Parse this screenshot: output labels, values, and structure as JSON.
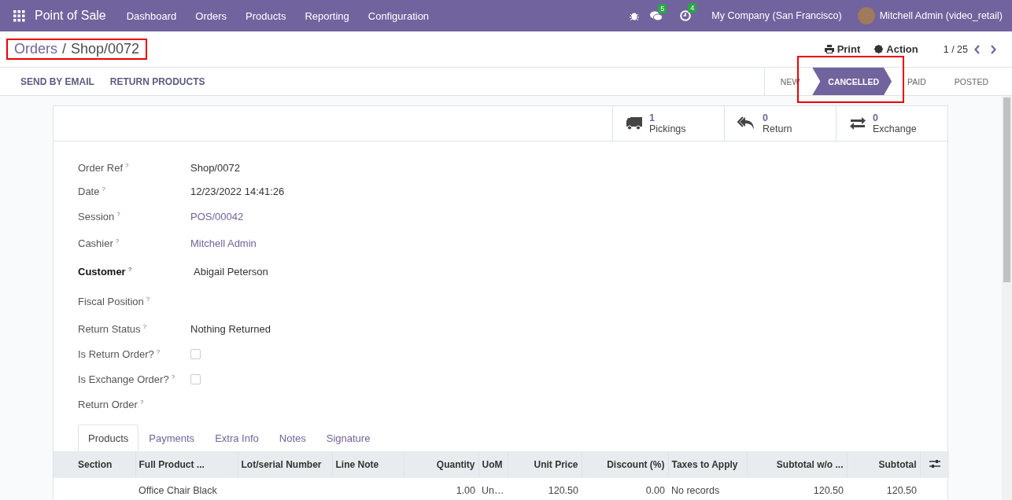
{
  "navbar": {
    "app": "Point of Sale",
    "menus": [
      "Dashboard",
      "Orders",
      "Products",
      "Reporting",
      "Configuration"
    ],
    "messages_count": "5",
    "activities_count": "4",
    "company": "My Company (San Francisco)",
    "user": "Mitchell Admin (video_retail)"
  },
  "breadcrumb": {
    "parent": "Orders",
    "separator": "/",
    "current": "Shop/0072"
  },
  "actions": [
    {
      "kind": "print",
      "label": "Print"
    },
    {
      "kind": "action",
      "label": "Action"
    }
  ],
  "pager": "1 / 25",
  "header_buttons": [
    "SEND BY EMAIL",
    "RETURN PRODUCTS"
  ],
  "statusbar": [
    {
      "label": "NEW",
      "selected": false
    },
    {
      "label": "CANCELLED",
      "selected": true
    },
    {
      "label": "PAID",
      "selected": false
    },
    {
      "label": "POSTED",
      "selected": false
    }
  ],
  "smart_buttons": [
    {
      "kind": "truck",
      "count": "1",
      "label": "Pickings"
    },
    {
      "kind": "return",
      "count": "0",
      "label": "Return"
    },
    {
      "kind": "exchange",
      "count": "0",
      "label": "Exchange"
    }
  ],
  "fields": [
    {
      "label": "Order Ref",
      "kind": "text",
      "value": "Shop/0072",
      "required": false
    },
    {
      "label": "Date",
      "kind": "text",
      "value": "12/23/2022 14:41:26",
      "required": false
    },
    {
      "label": "Session",
      "kind": "link",
      "value": "POS/00042",
      "required": false
    },
    {
      "label": "Cashier",
      "kind": "link",
      "value": "Mitchell Admin",
      "required": false
    },
    {
      "label": "Customer",
      "kind": "text",
      "value": "Abigail Peterson",
      "required": true
    },
    {
      "label": "Fiscal Position",
      "kind": "empty",
      "required": false
    },
    {
      "label": "Return Status",
      "kind": "text",
      "value": "Nothing Returned",
      "required": false
    },
    {
      "label": "Is Return Order?",
      "kind": "checkbox",
      "checked": false,
      "required": false
    },
    {
      "label": "Is Exchange Order?",
      "kind": "checkbox",
      "checked": false,
      "required": false
    },
    {
      "label": "Return Order",
      "kind": "empty",
      "required": false
    }
  ],
  "help_mark": "?",
  "tabs": [
    {
      "label": "Products",
      "selected": true
    },
    {
      "label": "Payments",
      "selected": false
    },
    {
      "label": "Extra Info",
      "selected": false
    },
    {
      "label": "Notes",
      "selected": false
    },
    {
      "label": "Signature",
      "selected": false
    }
  ],
  "table": {
    "columns": [
      {
        "label": "Section",
        "kind": "text"
      },
      {
        "label": "Full Product ...",
        "kind": "text"
      },
      {
        "label": "Lot/serial Number",
        "kind": "text"
      },
      {
        "label": "Line Note",
        "kind": "text"
      },
      {
        "label": "Quantity",
        "kind": "number"
      },
      {
        "label": "UoM",
        "kind": "text"
      },
      {
        "label": "Unit Price",
        "kind": "number"
      },
      {
        "label": "Discount (%)",
        "kind": "number"
      },
      {
        "label": "Taxes to Apply",
        "kind": "text"
      },
      {
        "label": "Subtotal w/o ...",
        "kind": "number"
      },
      {
        "label": "Subtotal",
        "kind": "number"
      }
    ],
    "rows": [
      [
        "",
        "Office Chair Black",
        "",
        "",
        "1.00",
        "Un…",
        "120.50",
        "0.00",
        "No records",
        "120.50",
        "120.50"
      ]
    ]
  }
}
